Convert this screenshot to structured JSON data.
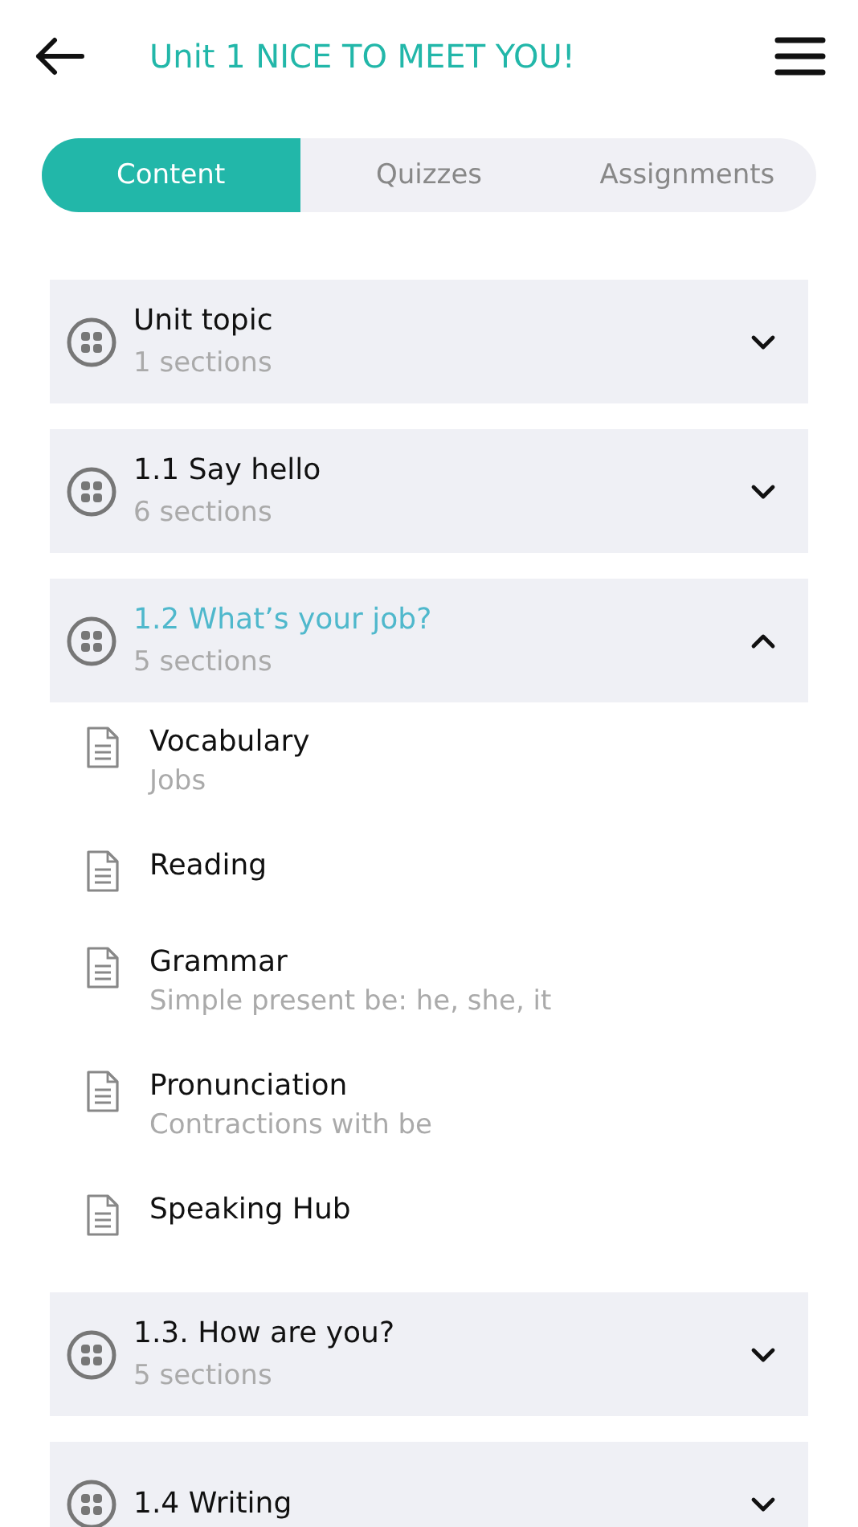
{
  "header": {
    "title": "Unit 1 NICE TO MEET YOU!"
  },
  "tabs": [
    {
      "label": "Content",
      "selected": true
    },
    {
      "label": "Quizzes",
      "selected": false
    },
    {
      "label": "Assignments",
      "selected": false
    }
  ],
  "sections": [
    {
      "title": "Unit topic",
      "subtitle": "1 sections",
      "expanded": false
    },
    {
      "title": "1.1 Say hello",
      "subtitle": "6 sections",
      "expanded": false
    },
    {
      "title": "1.2 What’s your job?",
      "subtitle": "5 sections",
      "expanded": true,
      "children": [
        {
          "title": "Vocabulary",
          "subtitle": "Jobs"
        },
        {
          "title": "Reading"
        },
        {
          "title": "Grammar",
          "subtitle": "Simple present be: he, she, it"
        },
        {
          "title": "Pronunciation",
          "subtitle": "Contractions with be"
        },
        {
          "title": "Speaking Hub"
        }
      ]
    },
    {
      "title": "1.3. How are you?",
      "subtitle": "5 sections",
      "expanded": false
    },
    {
      "title": "1.4 Writing",
      "expanded": false
    }
  ]
}
